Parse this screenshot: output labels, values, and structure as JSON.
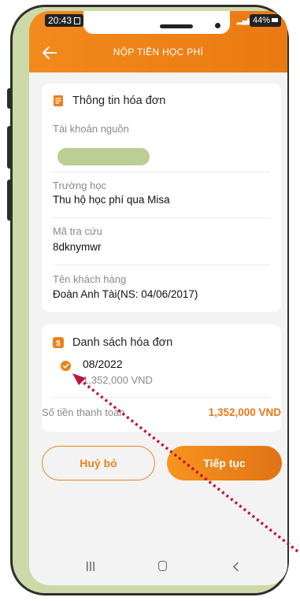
{
  "status_bar": {
    "time": "20:43",
    "battery": "44%"
  },
  "header": {
    "title": "NỘP TIỀN HỌC PHÍ"
  },
  "invoice_info": {
    "heading": "Thông tin hóa đơn",
    "source_account_label": "Tài khoản nguồn",
    "school_label": "Trường học",
    "school_value": "Thu hộ học phí qua Misa",
    "lookup_code_label": "Mã tra cứu",
    "lookup_code_value": "8dknymwr",
    "customer_name_label": "Tên khách hàng",
    "customer_name_value": "Đoàn Anh Tài(NS: 04/06/2017)"
  },
  "invoice_list": {
    "heading": "Danh sách hóa đơn",
    "items": [
      {
        "period": "08/2022",
        "amount": "1,352,000 VND"
      }
    ],
    "payment_label": "Số tiền thanh toán",
    "payment_total": "1,352,000 VND"
  },
  "actions": {
    "cancel": "Huỷ bỏ",
    "continue": "Tiếp tục"
  },
  "colors": {
    "accent": "#f07f16",
    "phone_frame": "#cdd9a8",
    "annotation_arrow": "#c0143c"
  }
}
